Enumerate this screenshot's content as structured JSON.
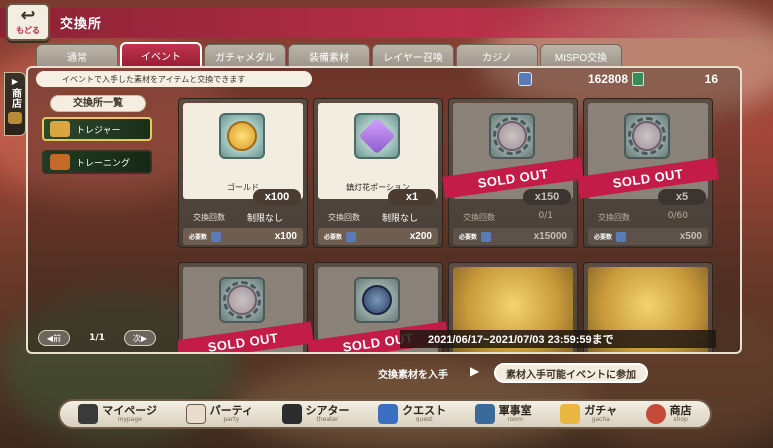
{
  "header": {
    "back_label": "もどる",
    "title": "交換所"
  },
  "tabs": [
    "通常",
    "イベント",
    "ガチャメダル",
    "装備素材",
    "レイヤー召喚",
    "カジノ",
    "MISPO交換"
  ],
  "active_tab": 1,
  "side_tab": {
    "label": "商店"
  },
  "info_text": "イベントで入手した素材をアイテムと交換できます",
  "currency": {
    "coins": "162808",
    "tickets": "16"
  },
  "list": {
    "title": "交換所一覧",
    "items": [
      {
        "label": "トレジャー",
        "icon": "treasure-icon"
      },
      {
        "label": "トレーニング",
        "icon": "training-icon"
      }
    ]
  },
  "pager": {
    "prev": "前",
    "page": "1/1",
    "next": "次"
  },
  "cards": [
    {
      "name": "ゴールド",
      "qty": "x100",
      "ex_label": "交換回数",
      "ex_value": "制限なし",
      "cost_label": "必要数",
      "cost": "x100",
      "sold_out": false,
      "icon": "gold-coin-icon"
    },
    {
      "name": "鎮灯花ポーション",
      "qty": "x1",
      "ex_label": "交換回数",
      "ex_value": "制限なし",
      "cost_label": "必要数",
      "cost": "x200",
      "sold_out": false,
      "icon": "potion-icon"
    },
    {
      "name": "",
      "qty": "x150",
      "ex_label": "交換回数",
      "ex_value": "0/1",
      "cost_label": "必要数",
      "cost": "x15000",
      "sold_out": true,
      "icon": "character-portrait-icon"
    },
    {
      "name": "",
      "qty": "x5",
      "ex_label": "交換回数",
      "ex_value": "0/60",
      "cost_label": "必要数",
      "cost": "x500",
      "sold_out": true,
      "icon": "character-portrait-icon"
    }
  ],
  "sold_out_label": "SOLD OUT",
  "period": "2021/06/17~2021/07/03 23:59:59まで",
  "acquire": {
    "text": "交換素材を入手",
    "button": "素材入手可能イベントに参加"
  },
  "nav": [
    {
      "label": "マイページ",
      "sub": "mypage",
      "icon": "mypage-icon"
    },
    {
      "label": "パーティ",
      "sub": "party",
      "icon": "party-icon"
    },
    {
      "label": "シアター",
      "sub": "theater",
      "icon": "theater-icon"
    },
    {
      "label": "クエスト",
      "sub": "quest",
      "icon": "quest-icon"
    },
    {
      "label": "軍事室",
      "sub": "room",
      "icon": "room-icon"
    },
    {
      "label": "ガチャ",
      "sub": "gacha",
      "icon": "gacha-icon"
    },
    {
      "label": "商店",
      "sub": "shop",
      "icon": "shop-icon"
    }
  ]
}
